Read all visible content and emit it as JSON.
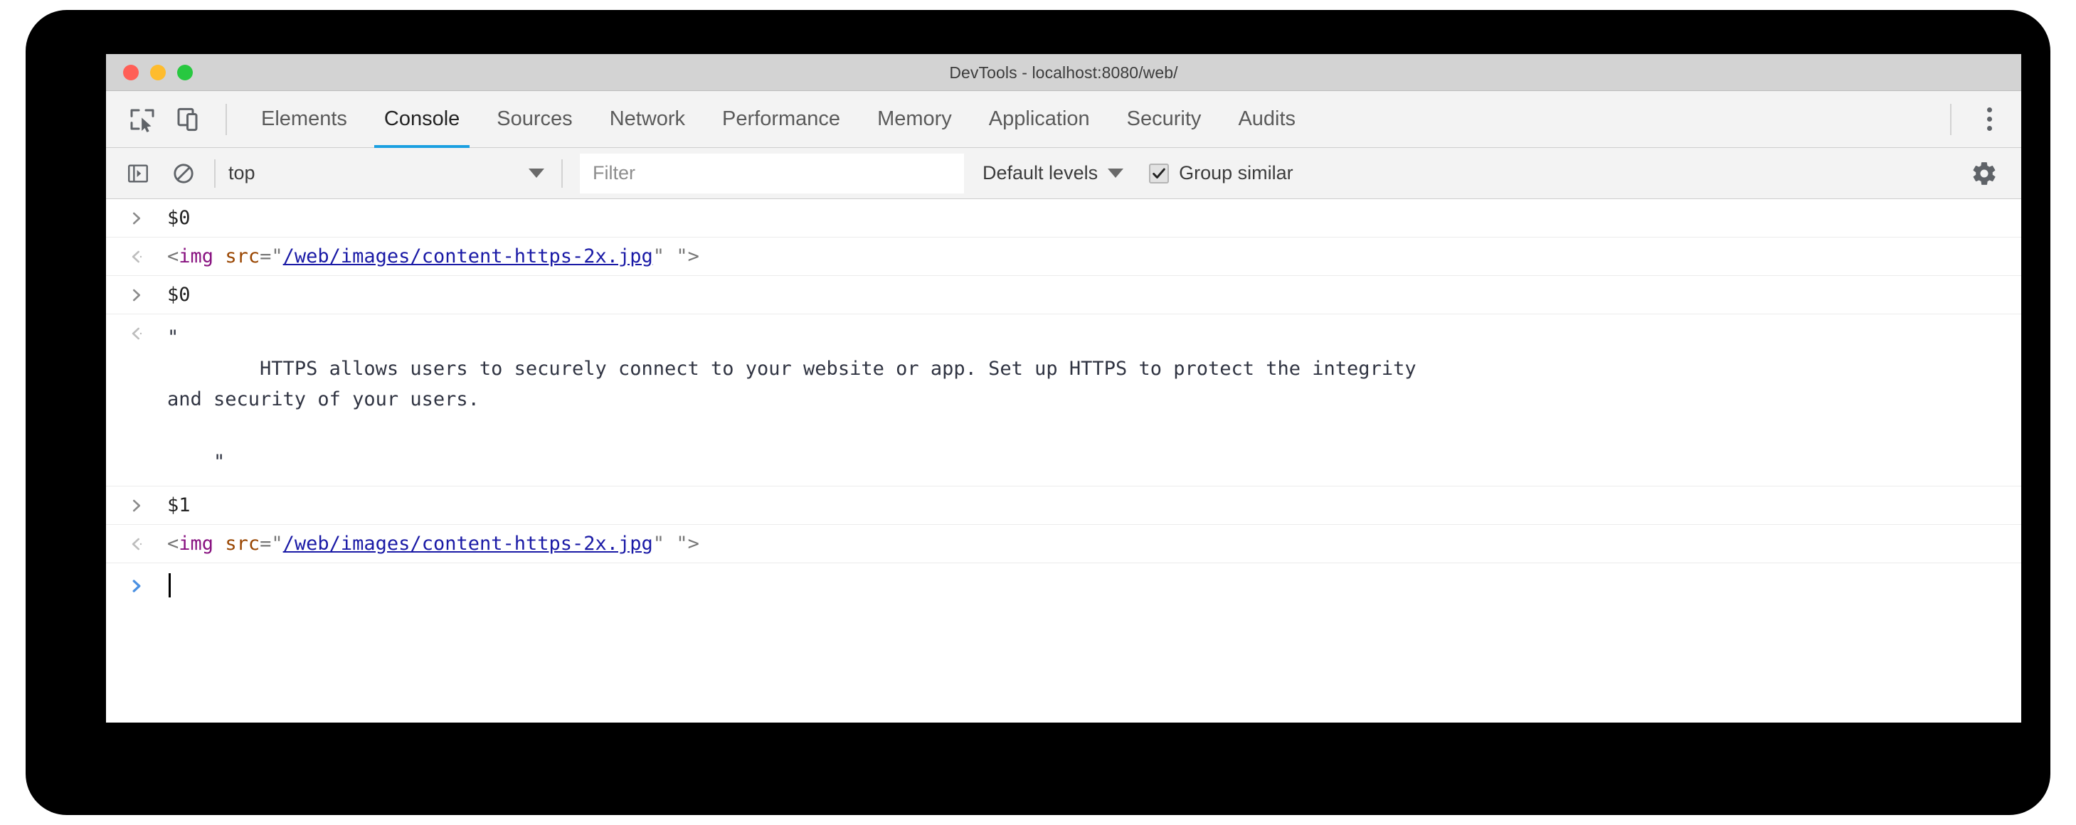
{
  "window": {
    "title": "DevTools - localhost:8080/web/",
    "traffic_lights": [
      {
        "name": "close",
        "color": "#ff5f57"
      },
      {
        "name": "minimize",
        "color": "#febc2e"
      },
      {
        "name": "maximize",
        "color": "#28c840"
      }
    ]
  },
  "tab_bar": {
    "inspect_icon": "inspect-element-icon",
    "device_icon": "device-toolbar-icon",
    "more_icon": "more-options-icon",
    "tabs": [
      {
        "label": "Elements",
        "active": false
      },
      {
        "label": "Console",
        "active": true
      },
      {
        "label": "Sources",
        "active": false
      },
      {
        "label": "Network",
        "active": false
      },
      {
        "label": "Performance",
        "active": false
      },
      {
        "label": "Memory",
        "active": false
      },
      {
        "label": "Application",
        "active": false
      },
      {
        "label": "Security",
        "active": false
      },
      {
        "label": "Audits",
        "active": false
      }
    ],
    "active_indicator_color": "#1a9fe0"
  },
  "filter_toolbar": {
    "sidebar_toggle_icon": "sidebar-toggle-icon",
    "clear_console_icon": "clear-console-icon",
    "context": "top",
    "filter_placeholder": "Filter",
    "filter_value": "",
    "levels_label": "Default levels",
    "group_similar_label": "Group similar",
    "group_similar_checked": true,
    "settings_icon": "gear-icon"
  },
  "console": {
    "rows": [
      {
        "type": "input",
        "marker": "input-chevron-icon",
        "text": "$0"
      },
      {
        "type": "result-html",
        "marker": "result-chevron-icon",
        "tag_open": "<",
        "tag_name": "img",
        "attr_name": "src",
        "equals": "=",
        "quote_open": "\"",
        "attr_value": "/web/images/content-https-2x.jpg",
        "quote_close": "\"",
        "trailing_quote": "\"",
        "tag_close": ">"
      },
      {
        "type": "input",
        "marker": "input-chevron-icon",
        "text": "$0"
      },
      {
        "type": "result-string",
        "marker": "result-chevron-icon",
        "text": "\"\n        HTTPS allows users to securely connect to your website or app. Set up HTTPS to protect the integrity\nand security of your users.\n\n    \""
      },
      {
        "type": "input",
        "marker": "input-chevron-icon",
        "text": "$1"
      },
      {
        "type": "result-html",
        "marker": "result-chevron-icon",
        "tag_open": "<",
        "tag_name": "img",
        "attr_name": "src",
        "equals": "=",
        "quote_open": "\"",
        "attr_value": "/web/images/content-https-2x.jpg",
        "quote_close": "\"",
        "trailing_quote": "\"",
        "tag_close": ">"
      }
    ],
    "prompt": {
      "marker": "prompt-chevron-icon",
      "value": "",
      "cursor_visible": true
    }
  },
  "colors": {
    "accent": "#1a9fe0",
    "tag": "#881280",
    "attribute": "#994500",
    "value_link": "#1a1aa6",
    "punctuation": "#777777",
    "title_bar": "#d3d3d3",
    "toolbar": "#f3f3f3"
  }
}
